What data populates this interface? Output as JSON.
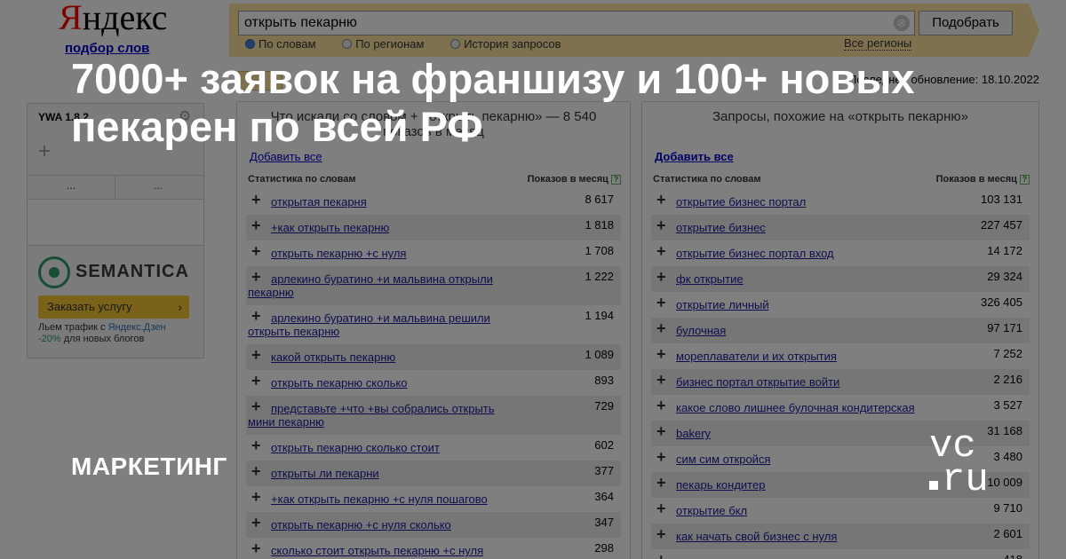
{
  "logo": {
    "brand": "Яндекс",
    "brand_first": "Я",
    "brand_rest": "ндекс",
    "subtitle": "подбор слов"
  },
  "search": {
    "value": "открыть пекарню",
    "clear_glyph": "⊗",
    "button_label": "Подобрать",
    "modes": [
      {
        "label": "По словам",
        "selected": true
      },
      {
        "label": "По регионам",
        "selected": false
      },
      {
        "label": "История запросов",
        "selected": false
      }
    ],
    "regions_link": "Все регионы"
  },
  "last_update": "Последнее обновление: 18.10.2022",
  "ywa": {
    "title": "YWA 1.8.2",
    "gear_icon": "gear-icon",
    "plus": "+",
    "cells": [
      "...",
      "..."
    ]
  },
  "semantica": {
    "name": "SEMANTICA",
    "button": "Заказать услугу",
    "promo_prefix": "Льем трафик с ",
    "promo_highlight": "Яндекс.Дзен",
    "promo_pct": "-20%",
    "promo_suffix": " для новых блогов"
  },
  "left_panel": {
    "header": "Что искали со словом + «открыть пекарню» — 8 540 показов в месяц",
    "link": "Добавить все",
    "col_query": "Статистика по словам",
    "col_count": "Показов в месяц",
    "rows": [
      {
        "query": "открытая пекарня",
        "count": "8 617"
      },
      {
        "query": "+как открыть пекарню",
        "count": "1 818"
      },
      {
        "query": "открыть пекарню +с нуля",
        "count": "1 708"
      },
      {
        "query": "арлекино буратино +и мальвина открыли пекарню",
        "count": "1 222"
      },
      {
        "query": "арлекино буратино +и мальвина решили открыть пекарню",
        "count": "1 194"
      },
      {
        "query": "какой открыть пекарню",
        "count": "1 089"
      },
      {
        "query": "открыть пекарню сколько",
        "count": "893"
      },
      {
        "query": "представьте +что +вы собрались открыть мини пекарню",
        "count": "729"
      },
      {
        "query": "открыть пекарню сколько стоит",
        "count": "602"
      },
      {
        "query": "открыты ли пекарни",
        "count": "377"
      },
      {
        "query": "+как открыть пекарню +с нуля пошагово",
        "count": "364"
      },
      {
        "query": "открыть пекарню +с нуля сколько",
        "count": "347"
      },
      {
        "query": "сколько стоит открыть пекарню +с нуля",
        "count": "298"
      }
    ]
  },
  "right_panel": {
    "header": "Запросы, похожие на «открыть пекарню»",
    "link": "Добавить все",
    "col_query": "Статистика по словам",
    "col_count": "Показов в месяц",
    "rows": [
      {
        "query": "открытие бизнес портал",
        "count": "103 131"
      },
      {
        "query": "открытие бизнес",
        "count": "227 457"
      },
      {
        "query": "открытие бизнес портал вход",
        "count": "14 172"
      },
      {
        "query": "фк открытие",
        "count": "29 324"
      },
      {
        "query": "открытие личный",
        "count": "326 405"
      },
      {
        "query": "булочная",
        "count": "97 171"
      },
      {
        "query": "мореплаватели и их открытия",
        "count": "7 252"
      },
      {
        "query": "бизнес портал открытие войти",
        "count": "2 216"
      },
      {
        "query": "какое слово лишнее булочная кондитерская",
        "count": "3 527"
      },
      {
        "query": "bakery",
        "count": "31 168"
      },
      {
        "query": "сим сим откройся",
        "count": "3 480"
      },
      {
        "query": "пекарь кондитер",
        "count": "10 009"
      },
      {
        "query": "открытие бкл",
        "count": "9 710"
      },
      {
        "query": "как начать свой бизнес с нуля",
        "count": "2 601"
      },
      {
        "query": "",
        "count": "418"
      }
    ]
  },
  "overlay": {
    "headline": "7000+ заявок на франшизу и 100+ новых пекарен по всей РФ",
    "tag": "МАРКЕТИНГ",
    "vc_top": "vc",
    "vc_bottom": "ru"
  }
}
